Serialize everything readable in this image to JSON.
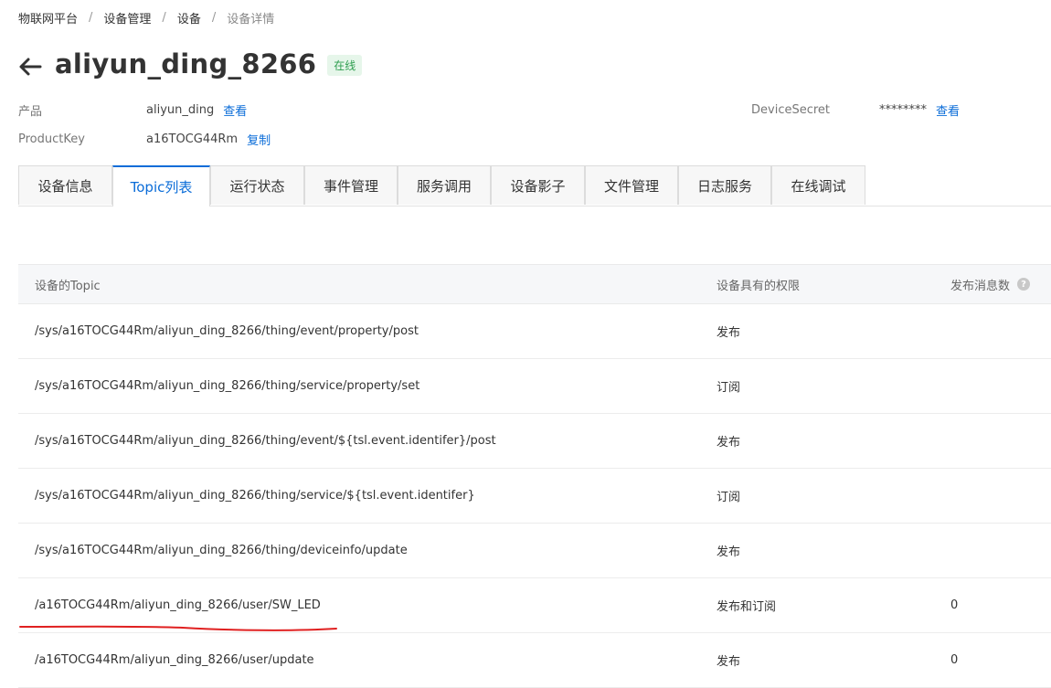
{
  "breadcrumb": [
    "物联网平台",
    "设备管理",
    "设备",
    "设备详情"
  ],
  "breadcrumb_separator": "/",
  "device": {
    "name": "aliyun_ding_8266",
    "status": "在线"
  },
  "info": {
    "product_label": "产品",
    "product_value": "aliyun_ding",
    "product_link": "查看",
    "productkey_label": "ProductKey",
    "productkey_value": "a16TOCG44Rm",
    "productkey_link": "复制",
    "secret_label": "DeviceSecret",
    "secret_value": "********",
    "secret_link": "查看"
  },
  "tabs": [
    {
      "label": "设备信息",
      "active": false
    },
    {
      "label": "Topic列表",
      "active": true
    },
    {
      "label": "运行状态",
      "active": false
    },
    {
      "label": "事件管理",
      "active": false
    },
    {
      "label": "服务调用",
      "active": false
    },
    {
      "label": "设备影子",
      "active": false
    },
    {
      "label": "文件管理",
      "active": false
    },
    {
      "label": "日志服务",
      "active": false
    },
    {
      "label": "在线调试",
      "active": false
    }
  ],
  "table": {
    "headers": {
      "topic": "设备的Topic",
      "permission": "设备具有的权限",
      "count": "发布消息数"
    },
    "help_glyph": "?",
    "rows": [
      {
        "topic": "/sys/a16TOCG44Rm/aliyun_ding_8266/thing/event/property/post",
        "permission": "发布",
        "count": ""
      },
      {
        "topic": "/sys/a16TOCG44Rm/aliyun_ding_8266/thing/service/property/set",
        "permission": "订阅",
        "count": ""
      },
      {
        "topic": "/sys/a16TOCG44Rm/aliyun_ding_8266/thing/event/${tsl.event.identifer}/post",
        "permission": "发布",
        "count": ""
      },
      {
        "topic": "/sys/a16TOCG44Rm/aliyun_ding_8266/thing/service/${tsl.event.identifer}",
        "permission": "订阅",
        "count": ""
      },
      {
        "topic": "/sys/a16TOCG44Rm/aliyun_ding_8266/thing/deviceinfo/update",
        "permission": "发布",
        "count": ""
      },
      {
        "topic": "/a16TOCG44Rm/aliyun_ding_8266/user/SW_LED",
        "permission": "发布和订阅",
        "count": "0"
      },
      {
        "topic": "/a16TOCG44Rm/aliyun_ding_8266/user/update",
        "permission": "发布",
        "count": "0"
      }
    ]
  },
  "colors": {
    "accent": "#0a6cd8",
    "online": "#2e9e4f",
    "annotation": "#e02020"
  },
  "icons": {
    "back": "arrow-left-icon",
    "help": "question-circle-icon"
  }
}
